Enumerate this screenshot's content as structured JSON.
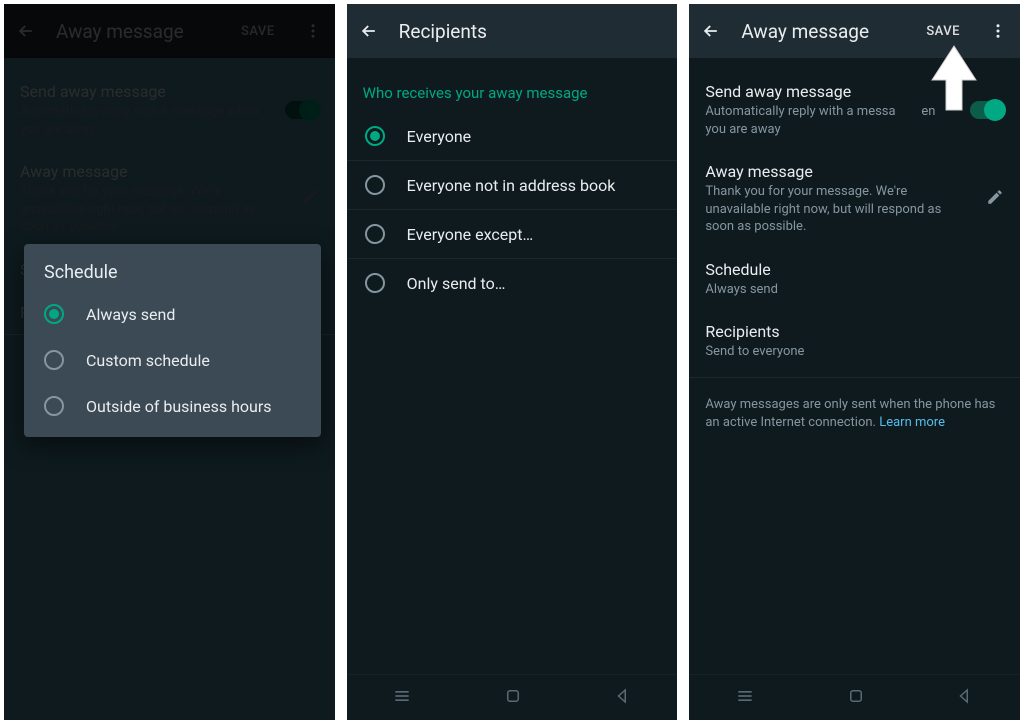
{
  "screen1": {
    "appbar": {
      "title": "Away message",
      "save_label": "SAVE"
    },
    "send": {
      "title": "Send away message",
      "sub": "Automatically reply with a message when you are away"
    },
    "msg": {
      "title": "Away message",
      "sub": "Thank you for your message. We're unavailable right now, but will respond as soon as possible."
    },
    "schedule_label": "Schedule",
    "recipients_prefix": "R",
    "dialog": {
      "title": "Schedule",
      "options": [
        {
          "label": "Always send"
        },
        {
          "label": "Custom schedule"
        },
        {
          "label": "Outside of business hours"
        }
      ]
    }
  },
  "screen2": {
    "appbar": {
      "title": "Recipients"
    },
    "header": "Who receives your away message",
    "options": [
      {
        "label": "Everyone"
      },
      {
        "label": "Everyone not in address book"
      },
      {
        "label": "Everyone except…"
      },
      {
        "label": "Only send to…"
      }
    ]
  },
  "screen3": {
    "appbar": {
      "title": "Away message",
      "save_label": "SAVE"
    },
    "send": {
      "title": "Send away message",
      "sub_a": "Automatically reply with a messa",
      "sub_b": "en",
      "sub_c": "you are away"
    },
    "msg": {
      "title": "Away message",
      "sub": "Thank you for your message. We're unavailable right now, but will respond as soon as possible."
    },
    "schedule": {
      "title": "Schedule",
      "sub": "Always send"
    },
    "recipients": {
      "title": "Recipients",
      "sub": "Send to everyone"
    },
    "footer": {
      "text": "Away messages are only sent when the phone has an active Internet connection. ",
      "link": "Learn more"
    }
  }
}
